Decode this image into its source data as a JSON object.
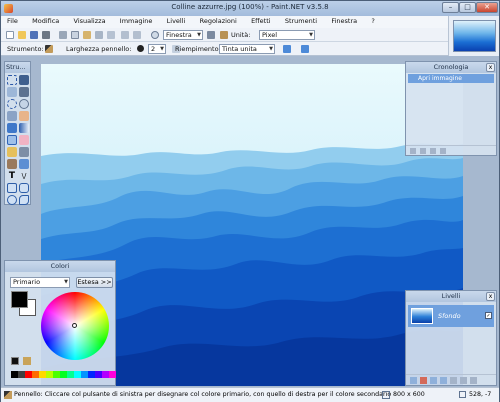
{
  "window": {
    "title": "Colline azzurre.jpg (100%) - Paint.NET v3.5.8",
    "min": "–",
    "max": "□",
    "close": "✕"
  },
  "menu": [
    "File",
    "Modifica",
    "Visualizza",
    "Immagine",
    "Livelli",
    "Regolazioni",
    "Effetti",
    "Strumenti",
    "Finestra",
    "?"
  ],
  "toolbar": {
    "zoom_value": "Finestra",
    "units_label": "Unità:",
    "units_value": "Pixel"
  },
  "toolbar2": {
    "tool_label": "Strumento:",
    "brush_width_label": "Larghezza pennello:",
    "brush_width_value": "2",
    "fill_label": "Riempimento:",
    "fill_value": "Tinta unita"
  },
  "tools_panel": {
    "title": "Stru..."
  },
  "history_panel": {
    "title": "Cronologia",
    "items": [
      "Apri immagine"
    ]
  },
  "colors_panel": {
    "title": "Colori",
    "mode": "Primario",
    "expand_button": "Estesa >>"
  },
  "layers_panel": {
    "title": "Livelli",
    "layers": [
      {
        "name": "Sfondo",
        "visible": true
      }
    ]
  },
  "status": {
    "message": "Pennello: Cliccare col pulsante di sinistra per disegnare col colore primario, con quello di destra per il colore secondario",
    "size": "800 x 600",
    "coords": "528, -7"
  },
  "colors": {
    "accent": "#3a7bd5",
    "selection": "#6fa0de",
    "chrome": "#cfd9e6"
  },
  "palette": [
    "#000000",
    "#404040",
    "#ff0000",
    "#ff6a00",
    "#ffd800",
    "#b6ff00",
    "#4cff00",
    "#00ff21",
    "#00ff90",
    "#00ffff",
    "#0094ff",
    "#0026ff",
    "#4800ff",
    "#b200ff",
    "#ff00dc",
    "#ff006e",
    "#ffffff"
  ]
}
